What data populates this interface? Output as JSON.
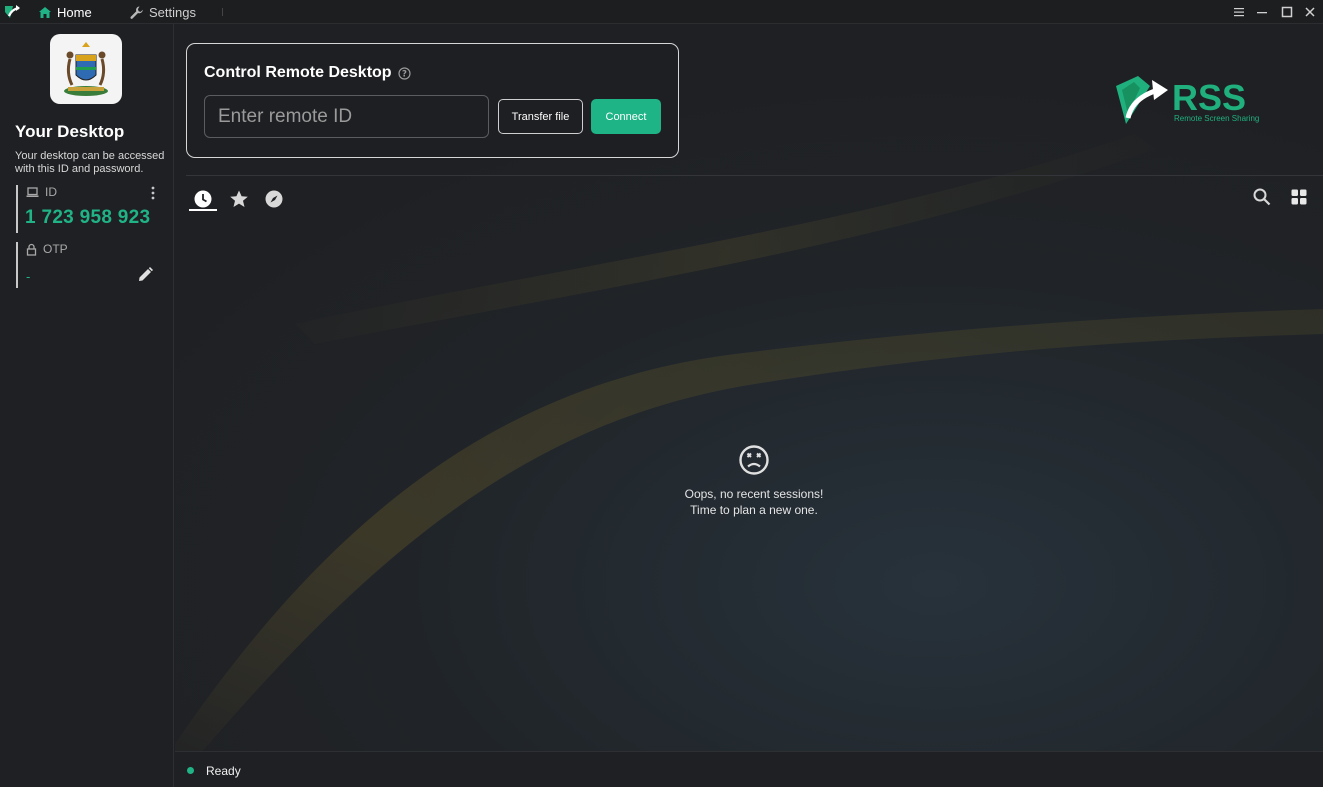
{
  "titlebar": {
    "tabs": [
      {
        "label": "Home",
        "icon": "home-icon"
      },
      {
        "label": "Settings",
        "icon": "wrench-icon"
      }
    ],
    "controls": [
      "menu-icon",
      "minimize-icon",
      "maximize-icon",
      "close-icon"
    ]
  },
  "sidebar": {
    "title": "Your Desktop",
    "description": "Your desktop can be accessed with this ID and password.",
    "id_label": "ID",
    "id_value": "1 723 958 923",
    "otp_label": "OTP",
    "otp_value": "-"
  },
  "control": {
    "title": "Control Remote Desktop",
    "input_placeholder": "Enter remote ID",
    "input_value": "",
    "transfer_label": "Transfer file",
    "connect_label": "Connect"
  },
  "logo": {
    "name": "RSS",
    "tagline": "Remote Screen Sharing"
  },
  "peers": {
    "tabs": [
      "recent-icon",
      "favorites-icon",
      "discovered-icon"
    ],
    "active_tab": "recent-icon",
    "empty_line1": "Oops, no recent sessions!",
    "empty_line2": "Time to plan a new one."
  },
  "status": {
    "text": "Ready"
  },
  "colors": {
    "accent": "#20b386",
    "background": "#1f2023",
    "card_border": "#d7d7d7"
  }
}
